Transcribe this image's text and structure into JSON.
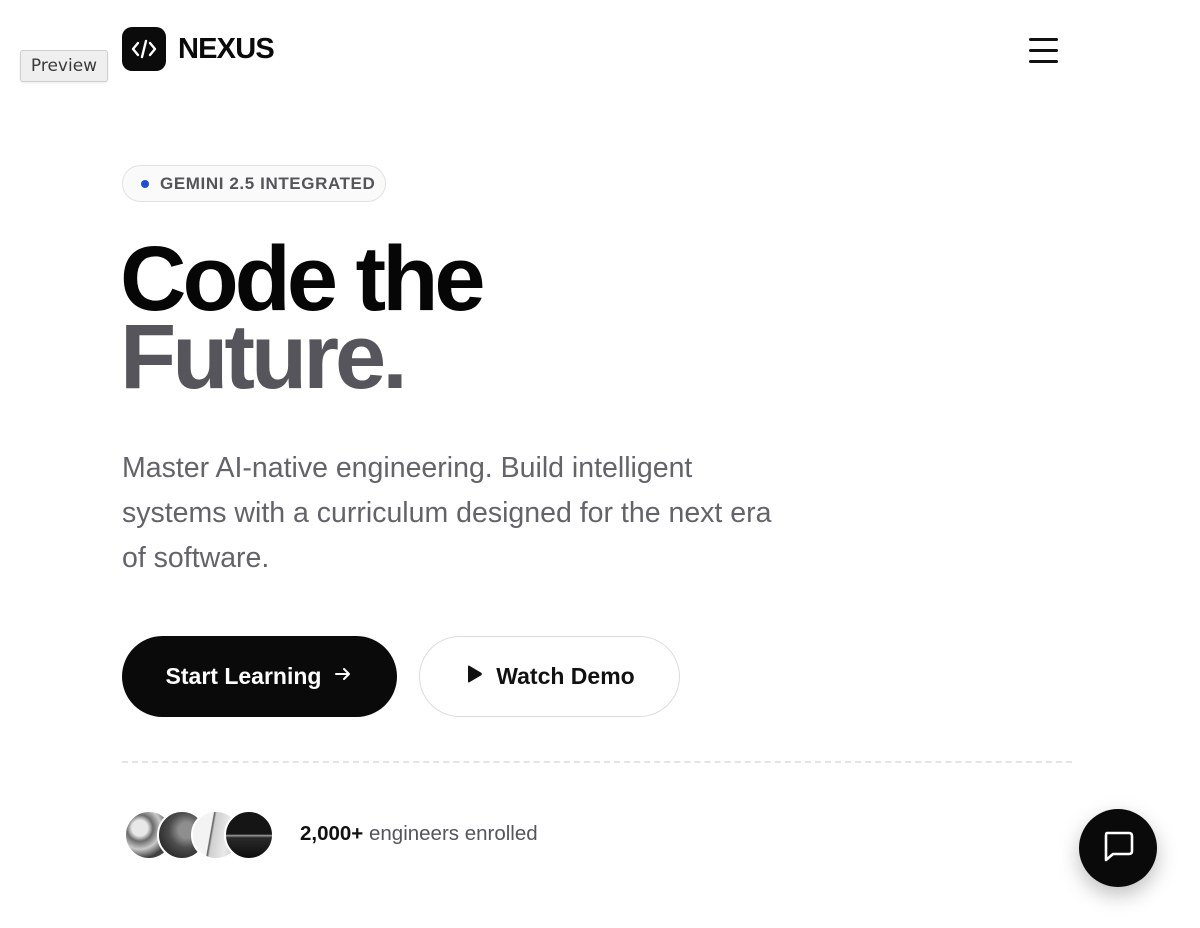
{
  "preview_label": "Preview",
  "brand": {
    "name": "NEXUS",
    "logo_icon": "code-brackets-icon"
  },
  "nav": {
    "menu_icon": "hamburger-menu-icon"
  },
  "badge": {
    "text": "GEMINI 2.5 INTEGRATED",
    "dot_color": "#1d4ed8"
  },
  "hero": {
    "headline_line1": "Code the",
    "headline_line2": "Future.",
    "description": "Master AI-native engineering. Build intelligent systems with a curriculum designed for the next era of software."
  },
  "actions": {
    "primary_label": "Start Learning",
    "primary_icon": "arrow-right-icon",
    "secondary_label": "Watch Demo",
    "secondary_icon": "play-icon"
  },
  "social_proof": {
    "count": "2,000+",
    "text": "engineers enrolled",
    "avatar_count": 4
  },
  "chat": {
    "icon": "chat-bubble-icon"
  },
  "colors": {
    "primary": "#0a0a0a",
    "muted_text": "#636369",
    "accent": "#1d4ed8"
  }
}
